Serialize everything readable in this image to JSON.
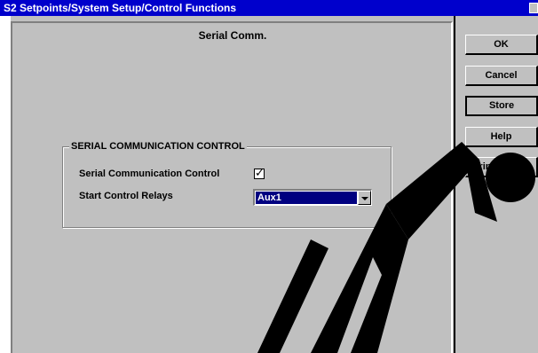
{
  "window": {
    "title": "S2 Setpoints/System Setup/Control Functions"
  },
  "panel": {
    "heading": "Serial Comm."
  },
  "group": {
    "legend": "SERIAL COMMUNICATION CONTROL",
    "fields": [
      {
        "label": "Serial Communication Control",
        "checked": true
      },
      {
        "label": "Start Control Relays",
        "value": "Aux1"
      }
    ]
  },
  "buttons": [
    {
      "label": "OK"
    },
    {
      "label": "Cancel"
    },
    {
      "label": "Store"
    },
    {
      "label": "Help"
    },
    {
      "label": "Print Screen"
    }
  ],
  "colors": {
    "titlebar": "#0000cc",
    "dialog_face": "#c0c0c0",
    "selection": "#000080"
  }
}
